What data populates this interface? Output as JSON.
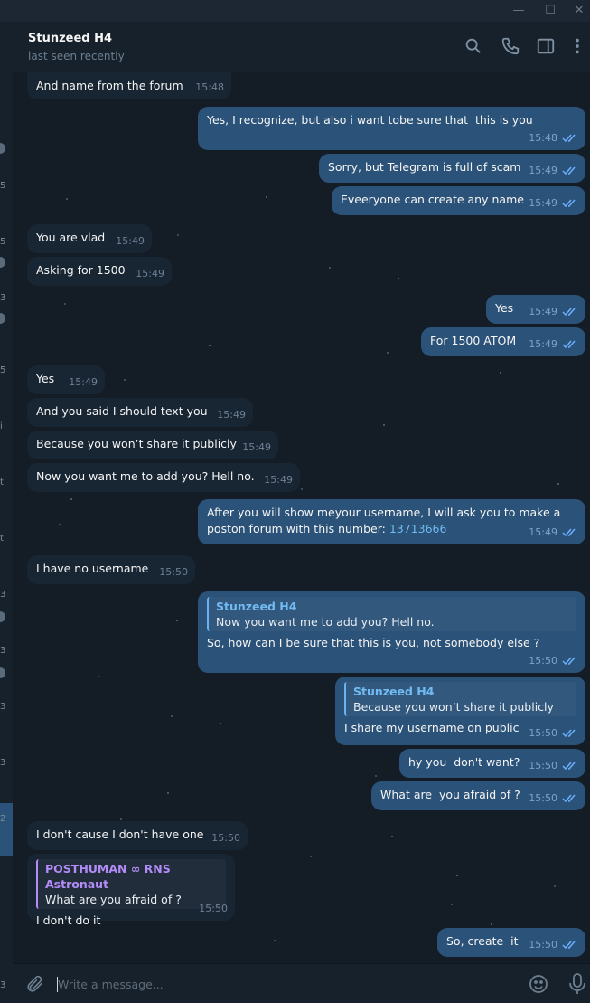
{
  "window": {
    "minimize": "—",
    "maximize": "☐",
    "close": "✕"
  },
  "sidebar": {
    "marks": [
      "5",
      "5",
      "3",
      "5",
      "i",
      "t",
      "t",
      "3",
      "3",
      "3",
      "3",
      "2",
      "3"
    ]
  },
  "header": {
    "name": "Stunzeed H4",
    "status": "last seen recently"
  },
  "messages": [
    {
      "dir": "in",
      "text": "And name from the forum",
      "time": "15:48"
    },
    {
      "dir": "out",
      "text": "Yes, I recognize, but also i want tobe sure that  this is you",
      "time": "15:48"
    },
    {
      "dir": "out",
      "text": "Sorry, but Telegram is full of scam",
      "time": "15:49"
    },
    {
      "dir": "out",
      "text": "Eveeryone can create any name",
      "time": "15:49"
    },
    {
      "dir": "in",
      "text": "You are vlad",
      "time": "15:49"
    },
    {
      "dir": "in",
      "text": "Asking for 1500",
      "time": "15:49"
    },
    {
      "dir": "out",
      "text": "Yes",
      "time": "15:49"
    },
    {
      "dir": "out",
      "text": "For 1500 ATOM",
      "time": "15:49"
    },
    {
      "dir": "in",
      "text": "Yes",
      "time": "15:49"
    },
    {
      "dir": "in",
      "text": "And you said I should text you",
      "time": "15:49"
    },
    {
      "dir": "in",
      "text": "Because you won’t share it publicly",
      "time": "15:49"
    },
    {
      "dir": "in",
      "text": "Now you want me to add you? Hell no.",
      "time": "15:49"
    },
    {
      "dir": "out",
      "text_line1": "After you will show meyour username, I will ask you to make a",
      "text_line2": "poston  forum with this  number: ",
      "link": "13713666",
      "time": "15:49"
    },
    {
      "dir": "in",
      "text": "I have no username",
      "time": "15:50"
    },
    {
      "dir": "out",
      "reply_name": "Stunzeed H4",
      "reply_text": "Now you want me to add you? Hell no.",
      "text": "So, how can I be sure that this is you, not somebody else ?",
      "time": "15:50"
    },
    {
      "dir": "out",
      "reply_name": "Stunzeed H4",
      "reply_text": "Because you won’t share it publicly",
      "text": "I share my username on public",
      "time": "15:50"
    },
    {
      "dir": "out",
      "text": "hy you  don't want?",
      "time": "15:50"
    },
    {
      "dir": "out",
      "text": "What are  you afraid of ?",
      "time": "15:50"
    },
    {
      "dir": "in",
      "text": "I don't cause I don't have one",
      "time": "15:50"
    },
    {
      "dir": "in",
      "reply_name": "POSTHUMAN ∞ RNS Astronaut",
      "reply_text": "What are  you afraid of ?",
      "text": "I don't do it",
      "time": "15:50"
    },
    {
      "dir": "out",
      "text": "So, create  it",
      "time": "15:50"
    }
  ],
  "composer": {
    "placeholder": "Write a message..."
  },
  "icons": [
    "search-icon",
    "phone-icon",
    "sidebar-toggle-icon",
    "more-vertical-icon",
    "attach-icon",
    "emoji-icon",
    "microphone-icon",
    "double-check-icon"
  ],
  "colors": {
    "bg": "#0e1621",
    "incoming": "#182533",
    "outgoing": "#2b5278",
    "accent": "#71baf2",
    "check": "#6cb0ff"
  }
}
